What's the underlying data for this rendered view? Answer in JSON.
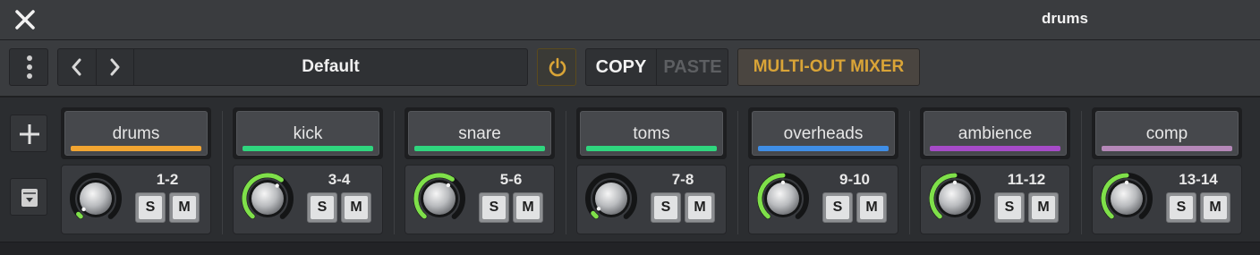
{
  "window": {
    "title": "drums"
  },
  "toolbar": {
    "preset": "Default",
    "copy_label": "COPY",
    "paste_label": "PASTE",
    "multi_out_label": "MULTI-OUT MIXER"
  },
  "strips": [
    {
      "name": "drums",
      "channels": "1-2",
      "color": "#f2a531",
      "ring_color": "#7fe04a",
      "level": 0.03,
      "solo": "S",
      "mute": "M"
    },
    {
      "name": "kick",
      "channels": "3-4",
      "color": "#2fd67e",
      "ring_color": "#7fe04a",
      "level": 0.63,
      "solo": "S",
      "mute": "M"
    },
    {
      "name": "snare",
      "channels": "5-6",
      "color": "#2fd67e",
      "ring_color": "#7fe04a",
      "level": 0.62,
      "solo": "S",
      "mute": "M"
    },
    {
      "name": "toms",
      "channels": "7-8",
      "color": "#2fd67e",
      "ring_color": "#7fe04a",
      "level": 0.04,
      "solo": "S",
      "mute": "M"
    },
    {
      "name": "overheads",
      "channels": "9-10",
      "color": "#3f8ee6",
      "ring_color": "#7fe04a",
      "level": 0.5,
      "solo": "S",
      "mute": "M"
    },
    {
      "name": "ambience",
      "channels": "11-12",
      "color": "#a64bc8",
      "ring_color": "#7fe04a",
      "level": 0.5,
      "solo": "S",
      "mute": "M"
    },
    {
      "name": "comp",
      "channels": "13-14",
      "color": "#b588b8",
      "ring_color": "#7fe04a",
      "level": 0.5,
      "solo": "S",
      "mute": "M"
    }
  ]
}
